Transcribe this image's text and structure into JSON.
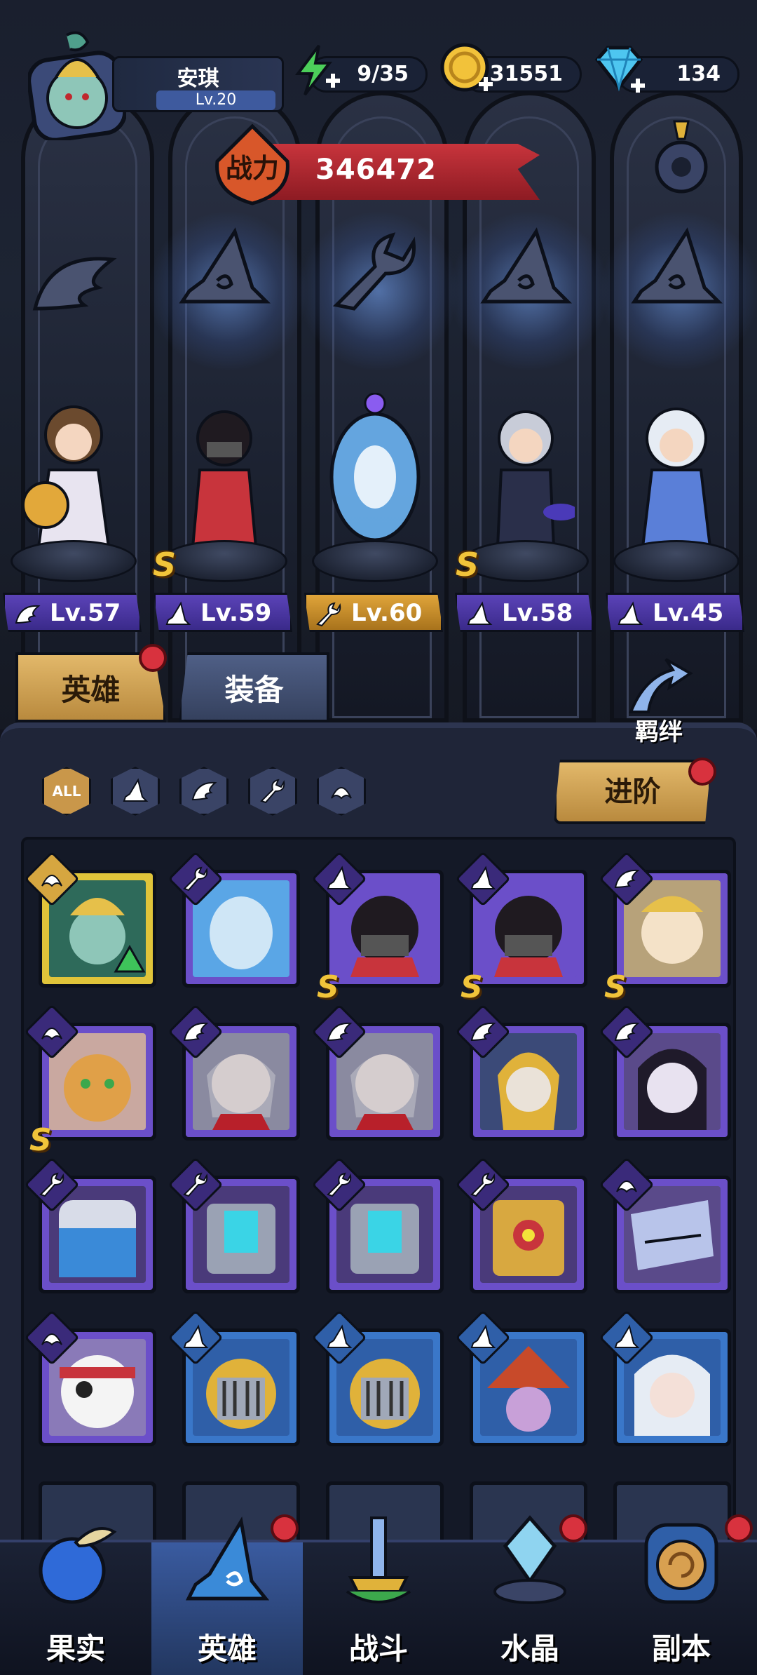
{
  "player": {
    "name": "安琪",
    "level": "Lv.20"
  },
  "resources": {
    "energy": "9/35",
    "gold": "31551",
    "diamonds": "134"
  },
  "power": {
    "label": "战力",
    "value": "346472"
  },
  "lineup": [
    {
      "level": "Lv.57",
      "class": "wing",
      "plate": "purple"
    },
    {
      "level": "Lv.59",
      "class": "hat",
      "plate": "purple",
      "s": true
    },
    {
      "level": "Lv.60",
      "class": "wrench",
      "plate": "gold"
    },
    {
      "level": "Lv.58",
      "class": "hat",
      "plate": "purple",
      "s": true
    },
    {
      "level": "Lv.45",
      "class": "hat",
      "plate": "purple"
    }
  ],
  "tabs": {
    "heroes": "英雄",
    "equipment": "装备"
  },
  "bond_label": "羁绊",
  "filters": {
    "all": "ALL"
  },
  "advance_button": "进阶",
  "s_mark": "S",
  "nav": {
    "fruit": "果实",
    "heroes": "英雄",
    "battle": "战斗",
    "crystal": "水晶",
    "dungeon": "副本"
  },
  "colors": {
    "purple_rarity": "#6b4fc9",
    "blue_rarity": "#3a77c9",
    "gold_rarity": "#e0c43a",
    "accent_gold": "#e2b86a",
    "notify_red": "#d8323e"
  }
}
